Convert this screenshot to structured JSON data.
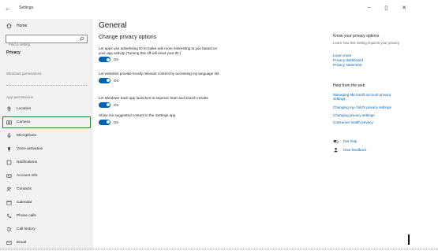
{
  "window": {
    "back": "←",
    "title": "Settings",
    "minimize": "–",
    "maximize": "▯",
    "close": "✕"
  },
  "sidebar": {
    "home": "Home",
    "search_placeholder": "Find a setting",
    "category": "Privacy",
    "windows_permissions": "Windows permissions",
    "app_permissions": "App permissions",
    "items": [
      {
        "label": "Location",
        "icon": "location-icon"
      },
      {
        "label": "Camera",
        "icon": "camera-icon",
        "selected": true
      },
      {
        "label": "Microphone",
        "icon": "microphone-icon"
      },
      {
        "label": "Voice activation",
        "icon": "voice-activation-icon"
      },
      {
        "label": "Notifications",
        "icon": "notifications-icon"
      },
      {
        "label": "Account info",
        "icon": "account-info-icon"
      },
      {
        "label": "Contacts",
        "icon": "contacts-icon"
      },
      {
        "label": "Calendar",
        "icon": "calendar-icon"
      },
      {
        "label": "Phone calls",
        "icon": "phone-icon"
      },
      {
        "label": "Call history",
        "icon": "history-icon"
      },
      {
        "label": "Email",
        "icon": "email-icon"
      }
    ]
  },
  "main": {
    "title": "General",
    "section": "Change privacy options",
    "settings": [
      {
        "desc": "Let apps use advertising ID to make ads more interesting to you based on your app activity (Turning this off will reset your ID.)",
        "state": "On"
      },
      {
        "desc": "Let websites provide locally relevant content by accessing my language list",
        "state": "On"
      },
      {
        "desc": "Let Windows track app launches to improve Start and search results",
        "state": "On"
      },
      {
        "desc": "Show me suggested content in the Settings app",
        "state": "On"
      }
    ]
  },
  "right": {
    "know_heading": "Know your privacy options",
    "know_text": "Learn how this setting impacts your privacy.",
    "links": [
      "Learn more",
      "Privacy dashboard",
      "Privacy statement"
    ],
    "help_heading": "Help from the web",
    "help_links": [
      "Managing Microsoft account privacy settings",
      "Changing my child's privacy settings",
      "Changing privacy settings",
      "Consumer health privacy"
    ],
    "get_help": "Get help",
    "give_feedback": "Give feedback"
  },
  "colors": {
    "accent": "#0063b1",
    "sidebar_bg": "#f2f2f2",
    "selection_outline": "#2e7d32"
  }
}
